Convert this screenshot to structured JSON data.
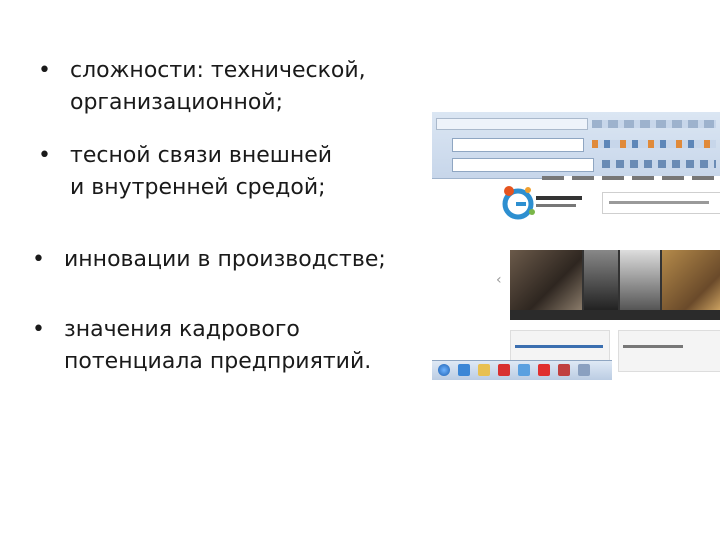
{
  "slide": {
    "bullet_glyph": "•",
    "bullets": [
      {
        "lines": [
          "сложности:  технической,",
          "организационной;"
        ]
      },
      {
        "lines": [
          "тесной связи внешней",
          " и  внутренней средой;"
        ]
      },
      {
        "lines": [
          "инновации в производстве;"
        ]
      },
      {
        "lines": [
          "значения кадрового",
          "потенциала предприятий."
        ]
      }
    ]
  },
  "screenshot": {
    "logo_icon": "europeana-logo-icon",
    "prev_icon": "chevron-left-icon"
  }
}
